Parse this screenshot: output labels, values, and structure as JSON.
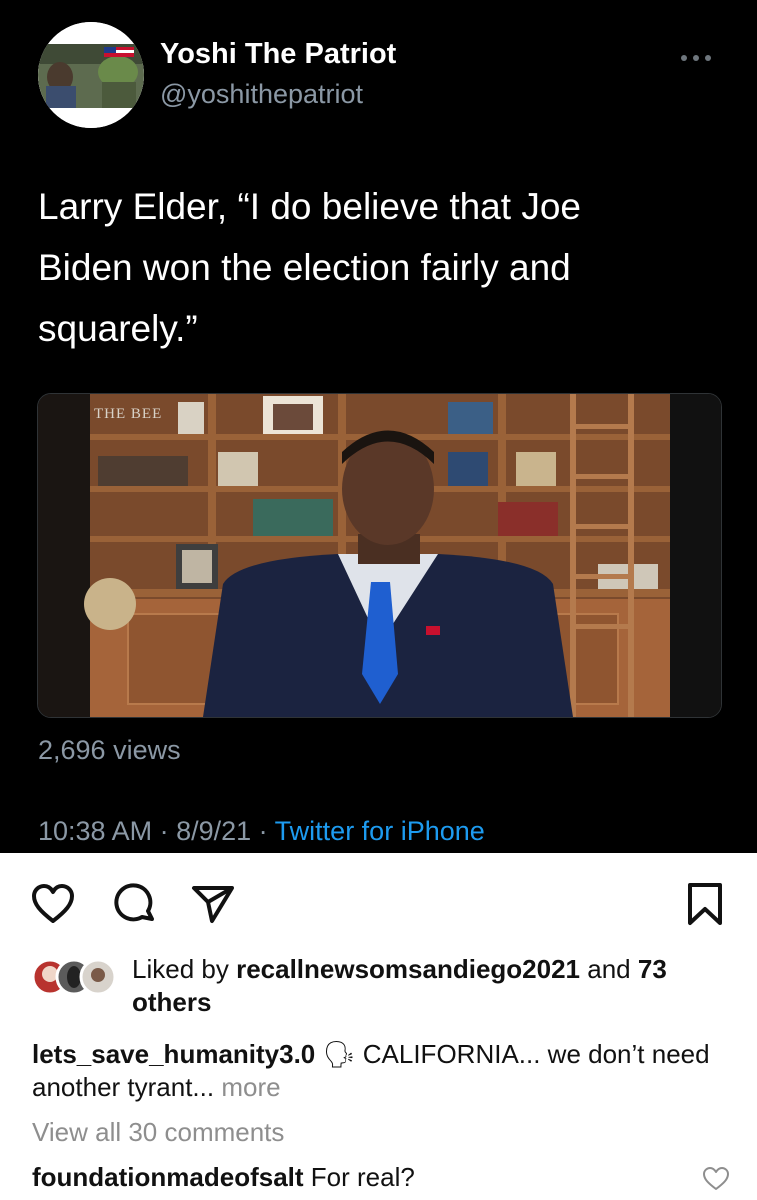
{
  "tweet": {
    "display_name": "Yoshi The Patriot",
    "handle": "@yoshithepatriot",
    "text": "Larry Elder, “I do believe that Joe Biden won the election fairly and squarely.”",
    "media_watermark": "THE BEE",
    "views": "2,696 views",
    "time": "10:38 AM",
    "sep": " · ",
    "date": "8/9/21",
    "source": "Twitter for iPhone"
  },
  "icons": {
    "more": "more-horizontal-icon",
    "like": "heart-icon",
    "comment": "comment-bubble-icon",
    "share": "paper-plane-icon",
    "save": "bookmark-icon"
  },
  "likes": {
    "prefix": "Liked by ",
    "user": "recallnewsomsandiego2021",
    "middle": " and ",
    "count": "73 others"
  },
  "caption": {
    "user": "lets_save_humanity3.0",
    "emoji": "🗣",
    "text": " CALIFORNIA... we don’t need another tyrant...",
    "more": " more"
  },
  "view_all_comments": "View all 30 comments",
  "comment": {
    "user": "foundationmadeofsalt",
    "text": " For real?"
  }
}
